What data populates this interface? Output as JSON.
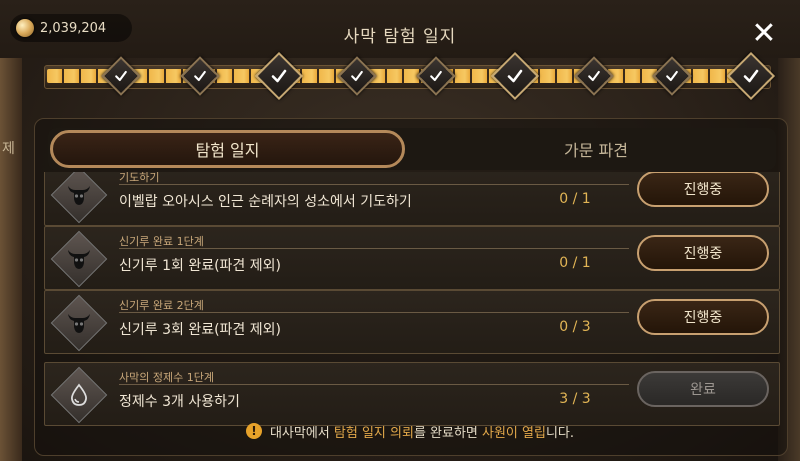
{
  "header": {
    "currency": {
      "icon": "coin-icon",
      "value": "2,039,204"
    },
    "title": "사막 탐험 일지",
    "close_icon": "close-icon"
  },
  "left_edge_text": "제",
  "progress": {
    "nodes": [
      {
        "checked": true,
        "big": false
      },
      {
        "checked": true,
        "big": false
      },
      {
        "checked": true,
        "big": true
      },
      {
        "checked": true,
        "big": false
      },
      {
        "checked": true,
        "big": false
      },
      {
        "checked": true,
        "big": true
      },
      {
        "checked": true,
        "big": false
      },
      {
        "checked": true,
        "big": false
      },
      {
        "checked": true,
        "big": true
      }
    ],
    "fill_fraction": 1.0
  },
  "tabs": [
    {
      "label": "탐험 일지",
      "active": true
    },
    {
      "label": "가문 파견",
      "active": false
    }
  ],
  "quests": [
    {
      "icon": "bull-skull-icon",
      "subtitle": "기도하기",
      "main": "이벨랍 오아시스 인근 순례자의 성소에서 기도하기",
      "count": "0 / 1",
      "button": "진행중",
      "state": "active"
    },
    {
      "icon": "bull-skull-icon",
      "subtitle": "신기루 완료 1단계",
      "main": "신기루 1회 완료(파견 제외)",
      "count": "0 / 1",
      "button": "진행중",
      "state": "active"
    },
    {
      "icon": "bull-skull-icon",
      "subtitle": "신기루 완료 2단계",
      "main": "신기루 3회 완료(파견 제외)",
      "count": "0 / 3",
      "button": "진행중",
      "state": "active"
    },
    {
      "icon": "water-drop-icon",
      "subtitle": "사막의 정제수 1단계",
      "main": "정제수 3개 사용하기",
      "count": "3 / 3",
      "button": "완료",
      "state": "done"
    }
  ],
  "notice": {
    "icon": "warning-icon",
    "part1": "대사막에서 ",
    "highlight1": "탐험 일지 의뢰",
    "part2": "를 완료하면 ",
    "highlight2": "사원이 열립",
    "part3": "니다."
  },
  "colors": {
    "accent_gold": "#e2b555",
    "highlight_orange": "#e2a84a",
    "button_border": "#c8a070"
  }
}
